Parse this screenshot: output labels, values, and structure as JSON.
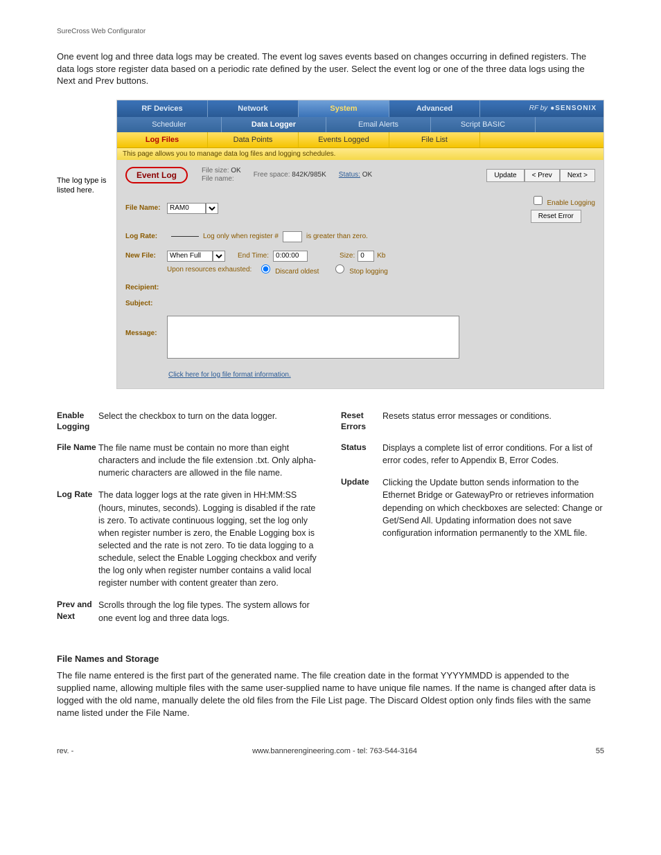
{
  "header_small": "SureCross Web Configurator",
  "intro": "One event log and three data logs may be created. The event log saves events based on changes occurring in defined registers. The data logs store register data based on a periodic rate defined by the user. Select the event log or one of the three data logs using the Next and Prev buttons.",
  "left_note": "The log type is listed here.",
  "topnav": [
    "RF Devices",
    "Network",
    "System",
    "Advanced"
  ],
  "brand_prefix": "RF by",
  "brand_name": "●SENSONIX",
  "subnav": [
    "Scheduler",
    "Data Logger",
    "Email Alerts",
    "Script BASIC"
  ],
  "subsubnav": [
    "Log Files",
    "Data Points",
    "Events Logged",
    "File List"
  ],
  "desc_bar": "This page allows you to manage data log files and logging schedules.",
  "panel": {
    "title": "Event Log",
    "file_size_lbl": "File size:",
    "file_size_val": "OK",
    "file_name_lbl": "File name:",
    "free_space_lbl": "Free space:",
    "free_space_val": "842K/985K",
    "status_link": "Status:",
    "status_val": "OK",
    "btn_update": "Update",
    "btn_prev": "< Prev",
    "btn_next": "Next >",
    "fn_label": "File Name:",
    "fn_value": "RAM0",
    "enable_logging": "Enable Logging",
    "reset_error": "Reset Error",
    "lr_label": "Log Rate:",
    "lr_text1": "Log only when register #",
    "lr_text2": "is greater than zero.",
    "nf_label": "New File:",
    "nf_value": "When Full",
    "end_time_lbl": "End Time:",
    "end_time_val": "0:00:00",
    "size_lbl": "Size:",
    "size_val": "0",
    "size_unit": "Kb",
    "exhausted_lbl": "Upon resources exhausted:",
    "opt_discard": "Discard oldest",
    "opt_stop": "Stop logging",
    "recipient_lbl": "Recipient:",
    "subject_lbl": "Subject:",
    "message_lbl": "Message:",
    "format_link": "Click here for log file format information."
  },
  "defs_left": [
    {
      "term": "Enable Logging",
      "text": "Select the checkbox to turn on the data logger."
    },
    {
      "term": "File Name",
      "text": "The file name must be contain no more than eight characters and include the file extension .txt. Only alpha-numeric characters are allowed in the file name."
    },
    {
      "term": "Log Rate",
      "text": "The data logger logs at the rate given in HH:MM:SS (hours, minutes, seconds). Logging is disabled if the rate is zero. To activate continuous logging, set the log only when register number is zero, the Enable Logging box is selected and the rate is not zero. To tie data logging to a schedule, select the Enable Logging checkbox and verify the log only when register number contains a valid local register number with content greater than zero."
    },
    {
      "term": "Prev and Next",
      "text": "Scrolls through the log file types. The system allows for one event log and three data logs."
    }
  ],
  "defs_right": [
    {
      "term": "Reset Errors",
      "text": "Resets status error messages or conditions."
    },
    {
      "term": "Status",
      "text": "Displays a complete list of error conditions. For a list of error codes, refer to Appendix B, Error Codes."
    },
    {
      "term": "Update",
      "text": "Clicking the Update button sends information to the Ethernet Bridge or GatewayPro or retrieves information depending on which checkboxes are selected: Change or Get/Send All. Updating information does not save configuration information permanently to the XML file."
    }
  ],
  "section_head": "File Names and Storage",
  "body_p": "The file name entered is the first part of the generated name. The file creation date in the format YYYYMMDD is appended to the supplied name, allowing multiple files with the same user-supplied name to have unique file names. If the name is changed after data is logged with the old name, manually delete the old files from the File List page. The Discard Oldest option only finds files with the same name listed under the File Name.",
  "footer": {
    "left": "rev. -",
    "center": "www.bannerengineering.com - tel: 763-544-3164",
    "right": "55"
  }
}
